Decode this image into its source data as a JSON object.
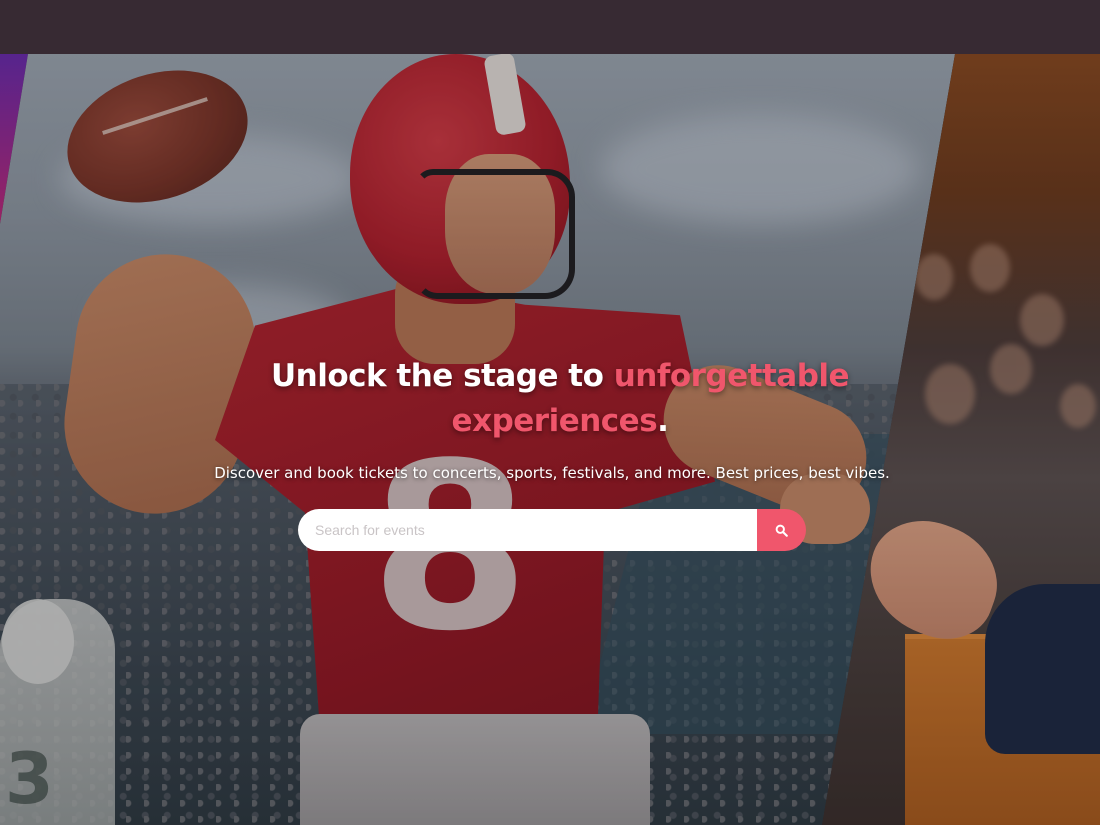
{
  "hero": {
    "headline_part1": "Unlock the stage to ",
    "headline_accent1": "unforgettable",
    "headline_accent2": "experiences",
    "headline_end": ".",
    "subtitle": "Discover and book tickets to concerts, sports, festivals, and more. Best prices, best vibes."
  },
  "search": {
    "placeholder": "Search for events",
    "button_icon": "search-icon"
  },
  "panels": {
    "left_image": "decorative-gradient",
    "center_image": "football-player-throwing",
    "right_image": "speaker-at-podium"
  },
  "colors": {
    "topbar": "#372a33",
    "accent": "#f0566c",
    "headline": "#ffffff"
  }
}
